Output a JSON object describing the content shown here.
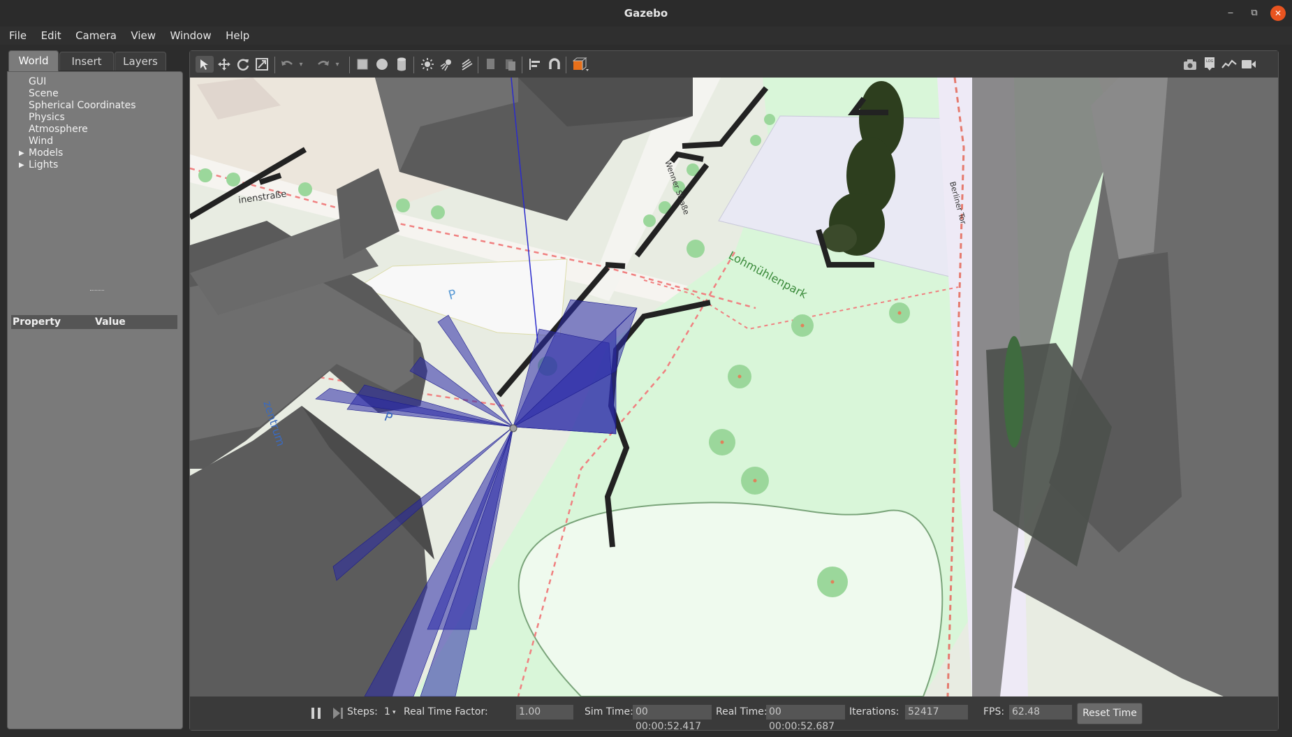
{
  "window": {
    "title": "Gazebo",
    "minimize": "‒",
    "restore": "⧉",
    "close": "✕"
  },
  "menubar": [
    "File",
    "Edit",
    "Camera",
    "View",
    "Window",
    "Help"
  ],
  "left_panel": {
    "tabs": [
      "World",
      "Insert",
      "Layers"
    ],
    "active_tab": "World",
    "tree": [
      {
        "label": "GUI",
        "expandable": false
      },
      {
        "label": "Scene",
        "expandable": false
      },
      {
        "label": "Spherical Coordinates",
        "expandable": false
      },
      {
        "label": "Physics",
        "expandable": false
      },
      {
        "label": "Atmosphere",
        "expandable": false
      },
      {
        "label": "Wind",
        "expandable": false
      },
      {
        "label": "Models",
        "expandable": true
      },
      {
        "label": "Lights",
        "expandable": true
      }
    ],
    "property_header": {
      "property": "Property",
      "value": "Value"
    }
  },
  "toolbar": {
    "left": [
      "select-arrow",
      "translate",
      "rotate",
      "scale",
      "undo",
      "undo-history",
      "redo",
      "redo-history",
      "box",
      "sphere",
      "cylinder",
      "point-light",
      "spot-light",
      "directional-light",
      "copy",
      "paste",
      "align",
      "snap",
      "change-view"
    ],
    "right": [
      "screenshot",
      "log",
      "plot",
      "record-video"
    ]
  },
  "map_labels": {
    "street1": "inenstraße",
    "street2": "Wenner Straße",
    "street3": "Berliner Tor",
    "park": "Lohmühlenpark",
    "district": "zentrum",
    "parking": "P"
  },
  "statusbar": {
    "steps_label": "Steps:",
    "steps_value": "1",
    "rtf_label": "Real Time Factor:",
    "rtf_value": "1.00",
    "sim_time_label": "Sim Time:",
    "sim_time_value": "00 00:00:52.417",
    "real_time_label": "Real Time:",
    "real_time_value": "00 00:00:52.687",
    "iterations_label": "Iterations:",
    "iterations_value": "52417",
    "fps_label": "FPS:",
    "fps_value": "62.48",
    "reset_button": "Reset Time"
  },
  "colors": {
    "laser": "#1a1a8c",
    "park": "#d4f5d4",
    "building": "#6b6b6b",
    "wall": "#1f1f1f"
  }
}
